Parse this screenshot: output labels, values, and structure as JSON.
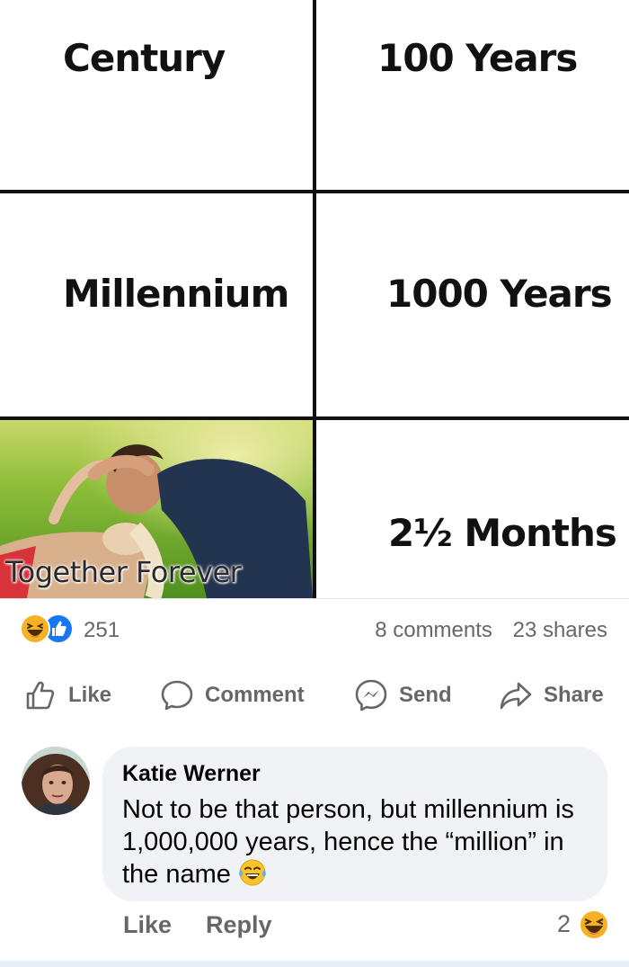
{
  "meme": {
    "rows": [
      {
        "left": "Century",
        "right": "100 Years"
      },
      {
        "left": "Millennium",
        "right": "1000 Years"
      },
      {
        "left": "",
        "right": "2½ Months"
      }
    ],
    "photo_caption": "Together Forever"
  },
  "reactions": {
    "icons": [
      "haha-icon",
      "like-icon"
    ],
    "count": "251",
    "comments": "8 comments",
    "shares": "23 shares"
  },
  "actions": {
    "like": "Like",
    "comment": "Comment",
    "send": "Send",
    "share": "Share"
  },
  "comment": {
    "author": "Katie Werner",
    "text": "Not to be that person, but millennium is 1,000,000 years, hence the “million” in the name",
    "emoji": "laughing-tears-icon",
    "like_label": "Like",
    "reply_label": "Reply",
    "reaction_count": "2",
    "reaction_icon": "haha-icon"
  },
  "colors": {
    "accent": "#1877f2",
    "muted_text": "#65676b",
    "bubble_bg": "#f0f2f5"
  }
}
